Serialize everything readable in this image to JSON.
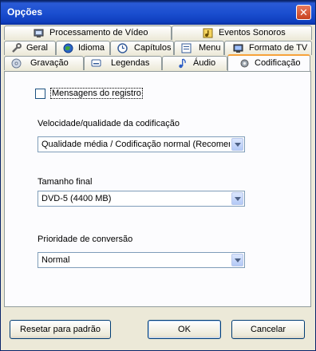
{
  "window": {
    "title": "Opções"
  },
  "tabs": {
    "row1": [
      "Processamento de Vídeo",
      "Eventos Sonoros"
    ],
    "row2": [
      "Geral",
      "Idioma",
      "Capítulos",
      "Menu",
      "Formato de TV"
    ],
    "row3": [
      "Gravação",
      "Legendas",
      "Áudio",
      "Codificação"
    ],
    "active": "Codificação"
  },
  "panel": {
    "log_checkbox": {
      "label": "Mensagens do registro",
      "checked": false
    },
    "speed": {
      "label": "Velocidade/qualidade da codificação",
      "value": "Qualidade média / Codificação normal (Recomendado)"
    },
    "size": {
      "label": "Tamanho final",
      "value": "DVD-5 (4400 MB)"
    },
    "priority": {
      "label": "Prioridade de conversão",
      "value": "Normal"
    }
  },
  "buttons": {
    "reset": "Resetar para padrão",
    "ok": "OK",
    "cancel": "Cancelar"
  }
}
